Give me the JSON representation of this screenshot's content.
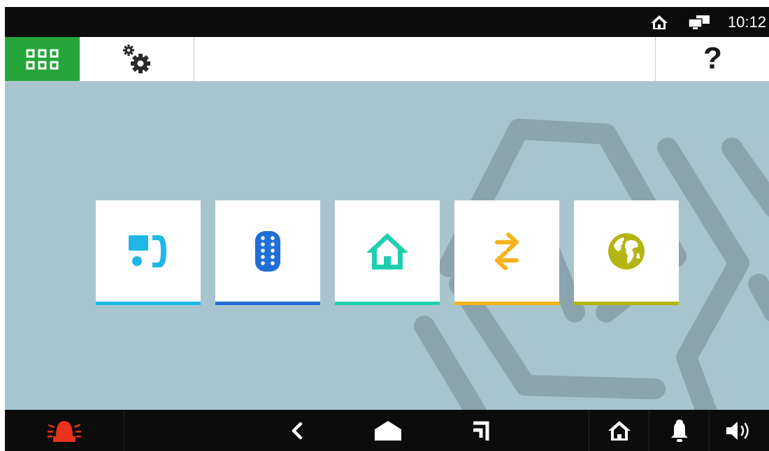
{
  "status_bar": {
    "time": "10:12",
    "icons": [
      "home-icon",
      "network-icon"
    ]
  },
  "header": {
    "apps_icon": "grid-icon",
    "settings_icon": "gears-icon",
    "help_label": "?"
  },
  "tiles": [
    {
      "icon": "intercom-handset-icon",
      "accent": "#1fb8e6"
    },
    {
      "icon": "remote-control-icon",
      "accent": "#1f6fd6"
    },
    {
      "icon": "house-icon",
      "accent": "#1fcfae"
    },
    {
      "icon": "swap-arrows-icon",
      "accent": "#f5b21c"
    },
    {
      "icon": "globe-icon",
      "accent": "#b3b612"
    }
  ],
  "nav_bar": {
    "buttons": [
      "alarm-icon",
      "back-icon",
      "home-icon",
      "recent-apps-icon",
      "house-icon",
      "bell-icon",
      "speaker-icon"
    ]
  },
  "colors": {
    "apps_button": "#26a53b",
    "background": "#a8c5cf",
    "bars": "#0c0c0c",
    "alarm": "#e8321c"
  }
}
